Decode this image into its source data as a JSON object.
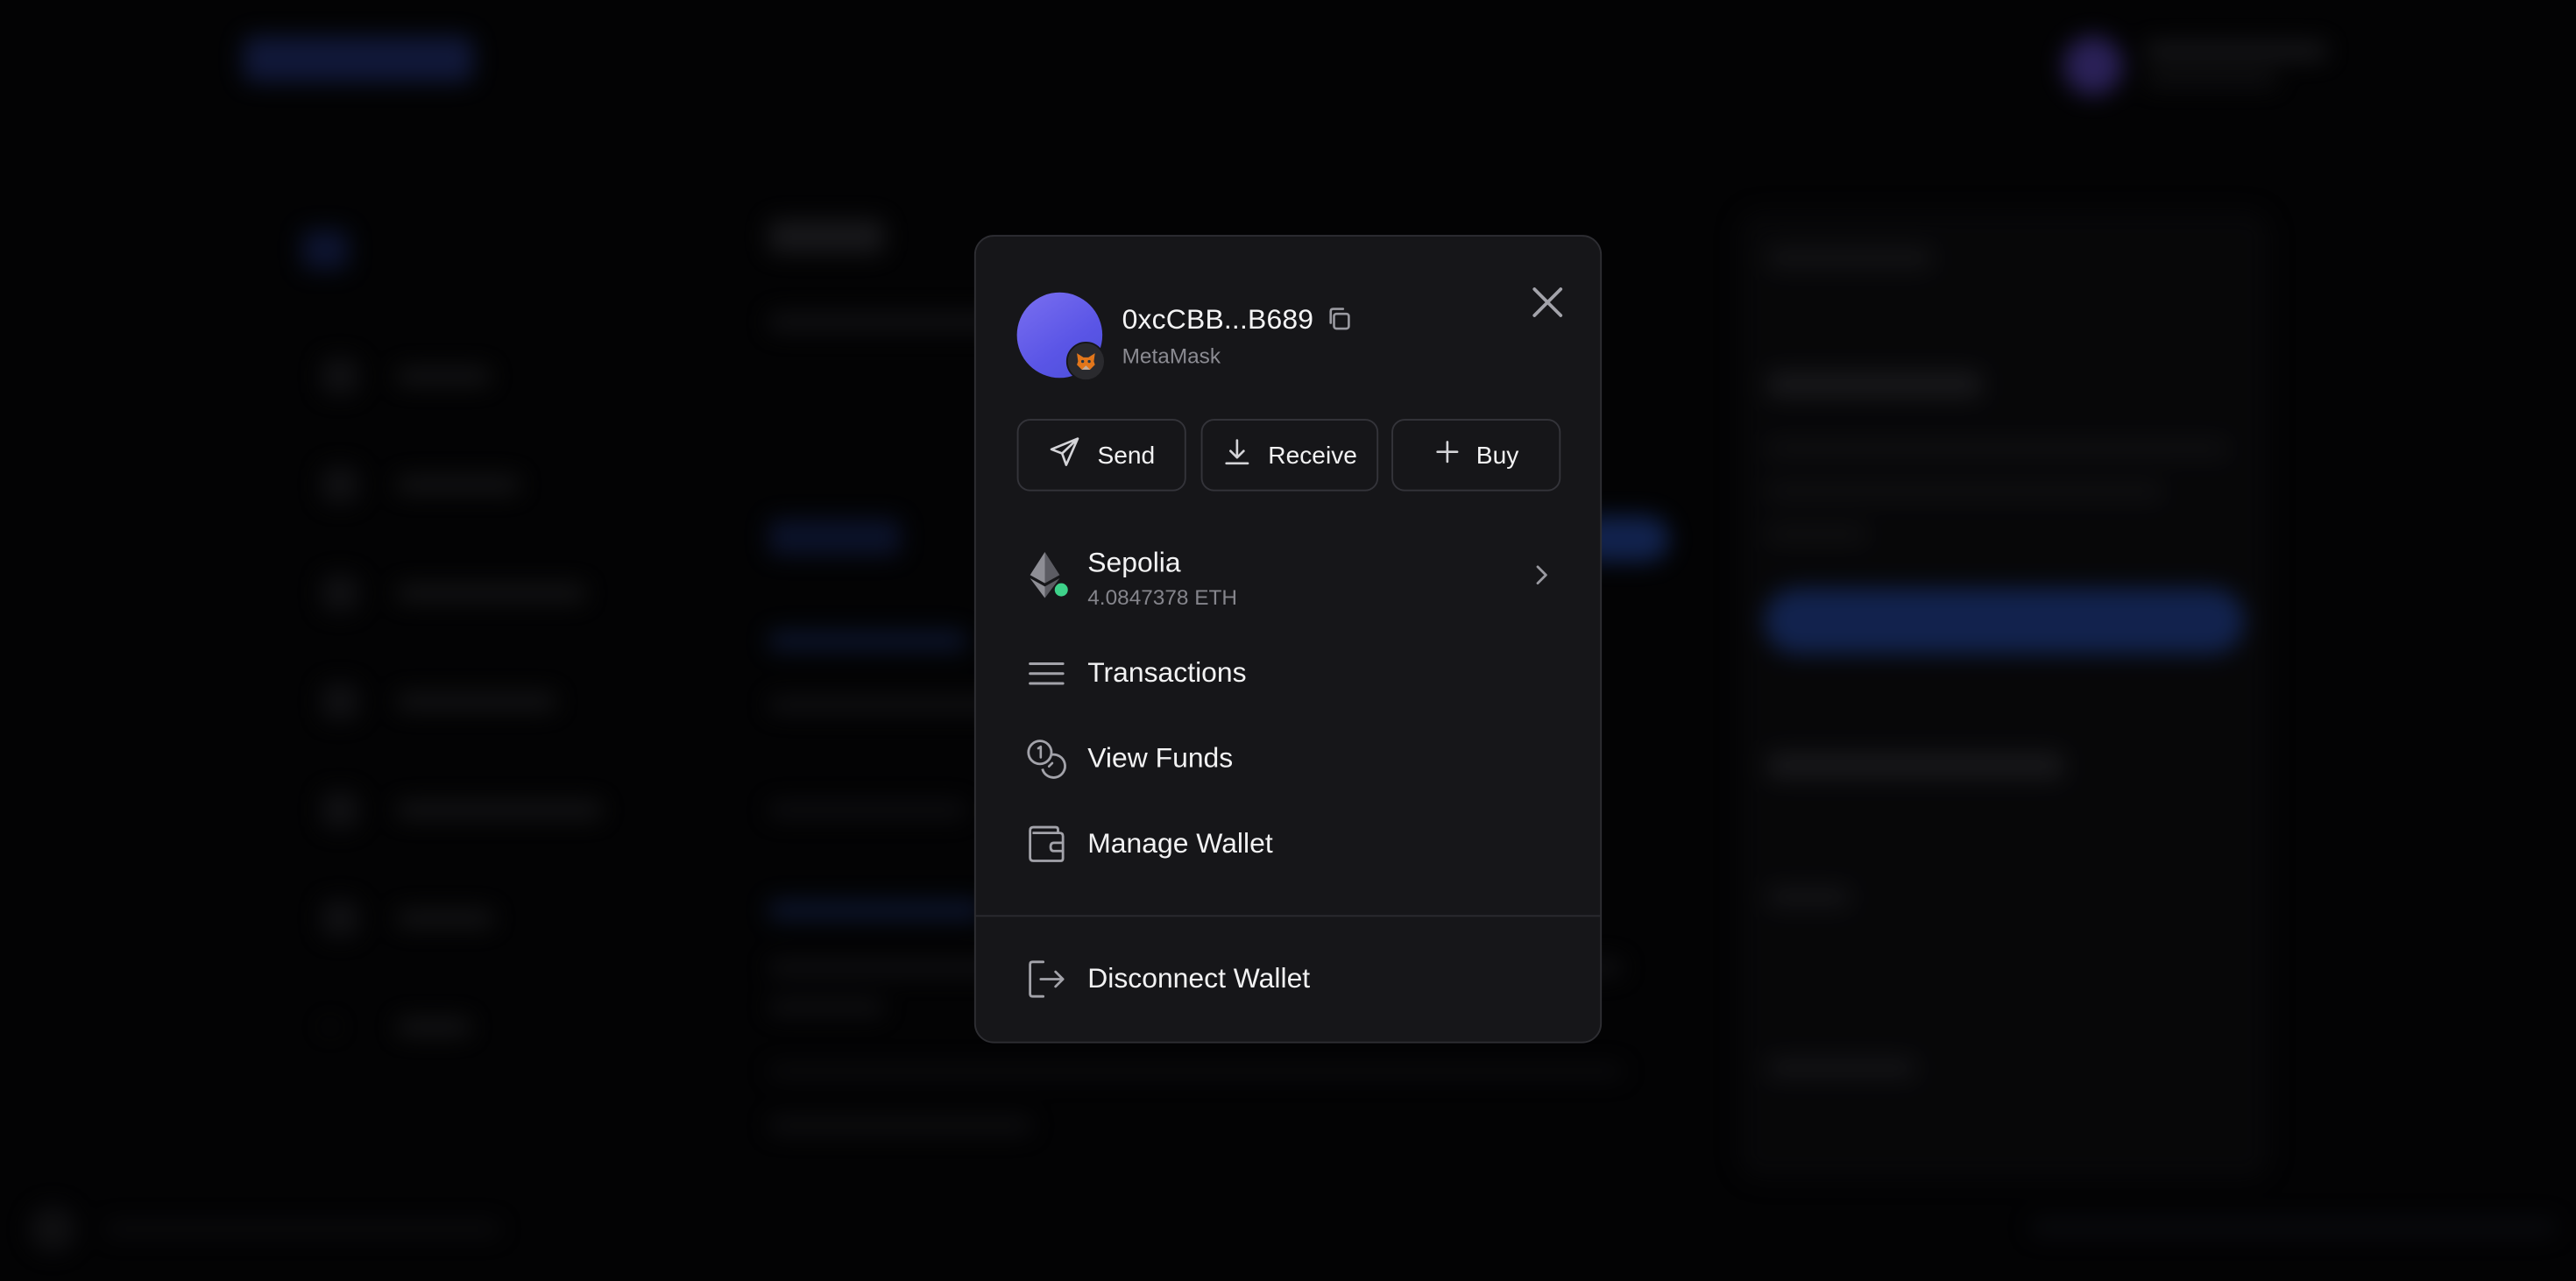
{
  "wallet": {
    "address": "0xcCBB...B689",
    "provider": "MetaMask",
    "avatar_color": "#6a63ee"
  },
  "actions": {
    "send_label": "Send",
    "receive_label": "Receive",
    "buy_label": "Buy"
  },
  "network": {
    "name": "Sepolia",
    "balance": "4.0847378 ETH",
    "status_color": "#3ed28a"
  },
  "menu": {
    "transactions_label": "Transactions",
    "view_funds_label": "View Funds",
    "manage_wallet_label": "Manage Wallet",
    "disconnect_label": "Disconnect Wallet"
  },
  "icons": {
    "close": "close-icon",
    "copy": "copy-icon",
    "wallet_badge": "metamask-fox-icon",
    "send": "send-icon",
    "receive": "download-icon",
    "buy": "plus-icon",
    "network": "ethereum-icon",
    "chevron": "chevron-right-icon",
    "transactions": "list-icon",
    "view_funds": "coins-icon",
    "manage_wallet": "wallet-icon",
    "disconnect": "logout-icon"
  }
}
